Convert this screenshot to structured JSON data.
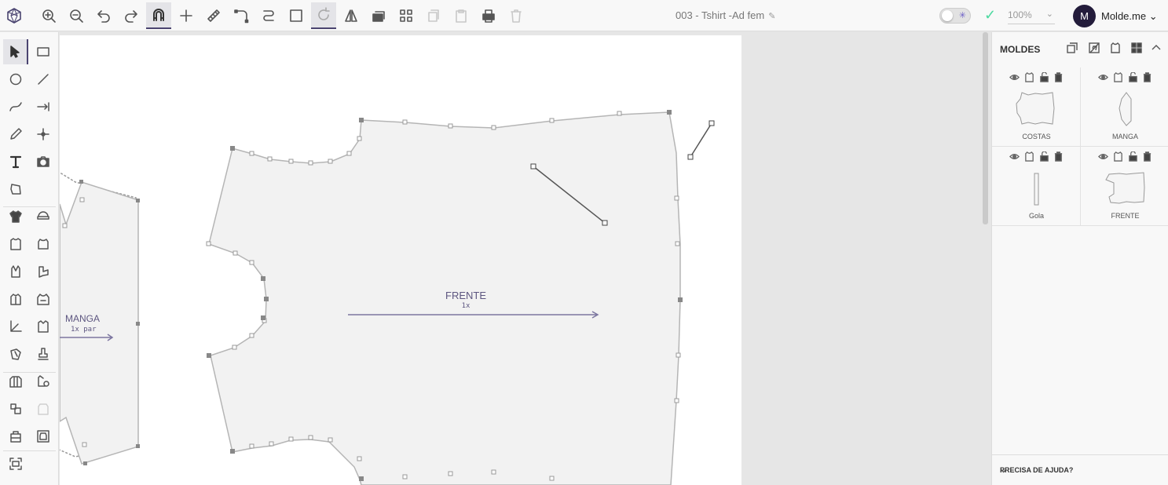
{
  "header": {
    "doc_title": "003 - Tshirt -Ad fem",
    "zoom": "100%",
    "user_initial": "M",
    "user_name": "Molde.me ⌄",
    "theme_icon": "sun-icon",
    "save_status_icon": "check-icon"
  },
  "toolbar": {
    "icons": [
      "logo-icon",
      "zoom-in-icon",
      "zoom-out-icon",
      "undo-icon",
      "redo-icon",
      "magnet-icon",
      "crosshair-icon",
      "ruler-icon",
      "corner-tool-icon",
      "curve-tool-icon",
      "select-rect-icon",
      "rotate-icon",
      "mirror-icon",
      "stack-icon",
      "grid-icon",
      "copy-icon",
      "paste-icon",
      "print-icon",
      "trash-icon"
    ]
  },
  "left_tools": {
    "icons": [
      "pointer-icon",
      "rectangle-icon",
      "circle-icon",
      "line-icon",
      "curve-icon",
      "dimension-icon",
      "pencil-icon",
      "point-icon",
      "text-icon",
      "camera-icon",
      "shape-icon",
      "tshirt-fill-icon",
      "hat-icon",
      "tshirt-outline-icon",
      "tshirt-narrow-icon",
      "vest-icon",
      "sleeve-icon",
      "jacket-icon",
      "hoodie-icon",
      "axis-icon",
      "shirt-icon",
      "mask-icon",
      "stamp-icon",
      "layers-icon",
      "magic-icon",
      "duplicate-icon",
      "piece-icon",
      "bag-icon",
      "frame-icon",
      "camera-scan-icon"
    ]
  },
  "canvas": {
    "front_label": "FRENTE",
    "front_qty": "1x",
    "sleeve_label": "MANGA",
    "sleeve_qty": "1x par"
  },
  "panel": {
    "title": "MOLDES",
    "header_icons": [
      "copy-icon",
      "mirror-icon",
      "tshirt-icon",
      "grid-icon",
      "chevron-up-icon"
    ],
    "pieces": [
      {
        "label": "COSTAS"
      },
      {
        "label": "MANGA"
      },
      {
        "label": "Gola"
      },
      {
        "label": "FRENTE"
      }
    ],
    "card_icons": [
      "eye-icon",
      "tshirt-icon",
      "lock-icon",
      "trash-icon"
    ],
    "help": "PRECISA DE AJUDA?"
  },
  "colors": {
    "accent": "#4a4470",
    "avatar_bg": "#231c3b",
    "success": "#4cd9a0",
    "pattern_fill": "#f2f2f2",
    "pattern_stroke": "#b5b5b5",
    "label_color": "#5d5680"
  }
}
